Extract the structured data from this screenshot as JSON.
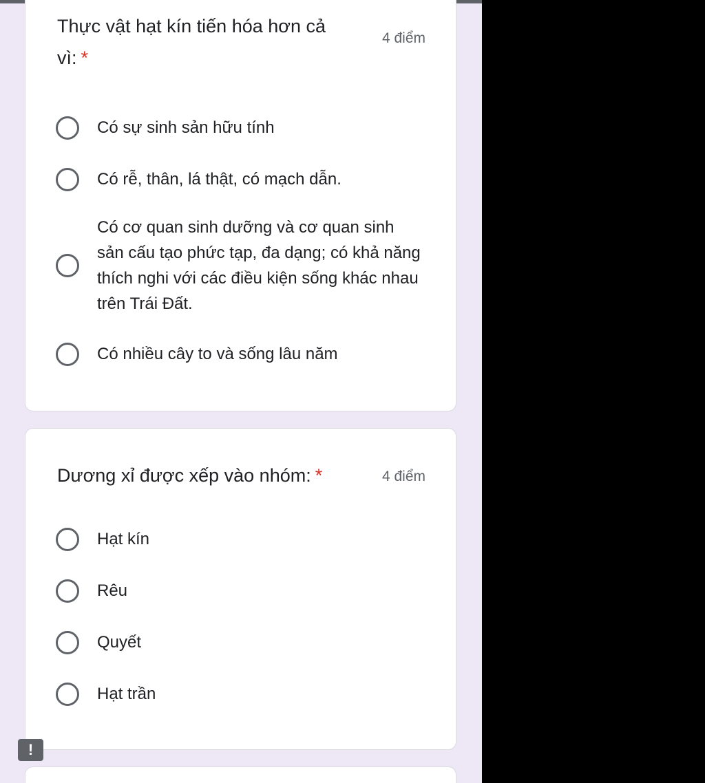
{
  "questions": [
    {
      "title": "Thực vật hạt kín tiến hóa hơn cả vì:",
      "required_mark": "*",
      "points": "4 điểm",
      "options": [
        "Có sự sinh sản hữu tính",
        "Có rễ, thân, lá thật, có mạch dẫn.",
        "Có cơ quan sinh dưỡng và cơ quan sinh sản cấu tạo phức tạp, đa dạng; có khả năng thích nghi với các điều kiện sống khác nhau trên Trái Đất.",
        "Có nhiều cây to và sống lâu năm"
      ]
    },
    {
      "title": "Dương xỉ được xếp vào nhóm:",
      "required_mark": "*",
      "points": "4 điểm",
      "options": [
        "Hạt kín",
        "Rêu",
        "Quyết",
        "Hạt trần"
      ]
    }
  ],
  "report_button": {
    "label": "!"
  }
}
